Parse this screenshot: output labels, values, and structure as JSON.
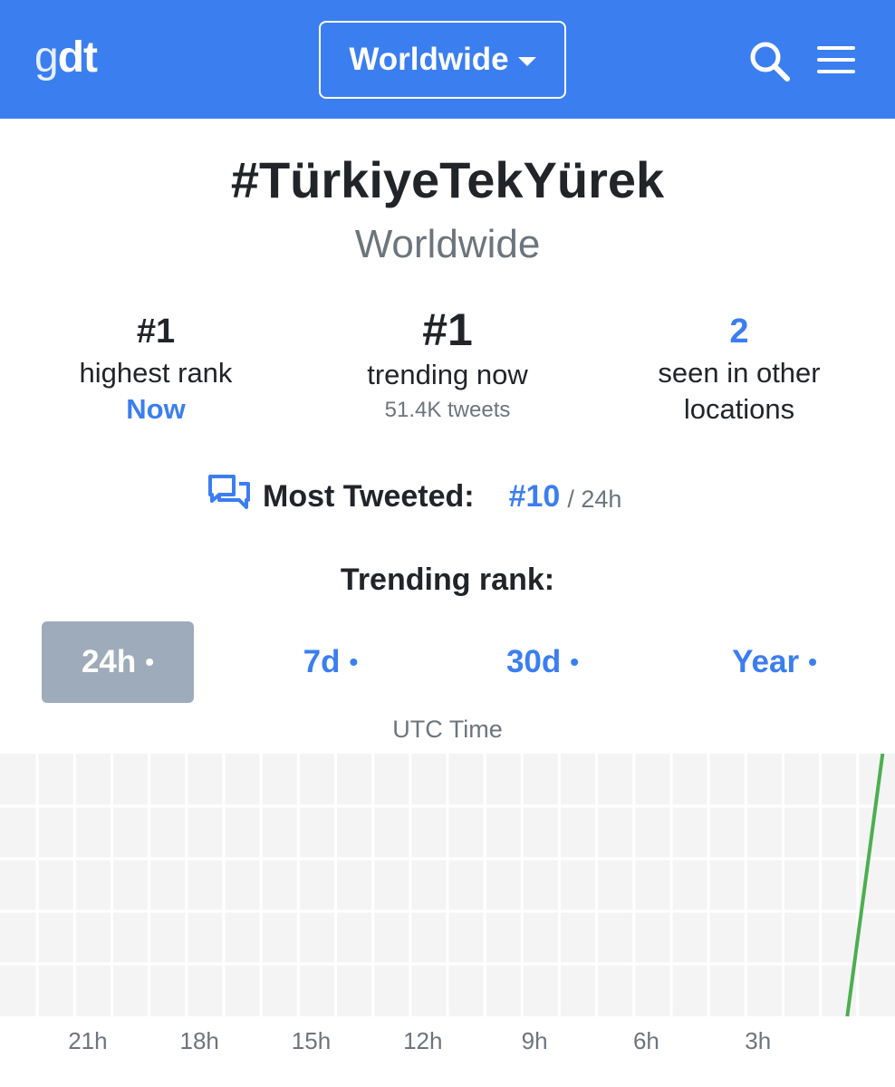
{
  "header": {
    "logo_light": "g",
    "logo_bold": "dt",
    "location_button": "Worldwide",
    "background_color": "#3b7ef0"
  },
  "trend": {
    "title": "#TürkiyeTekYürek",
    "location": "Worldwide"
  },
  "stats": {
    "highest_rank": {
      "value": "#1",
      "label": "highest rank",
      "when": "Now"
    },
    "trending_now": {
      "value": "#1",
      "label": "trending now",
      "tweets": "51.4K tweets"
    },
    "other_locations": {
      "value": "2",
      "label_line1": "seen in other",
      "label_line2": "locations"
    }
  },
  "most_tweeted": {
    "label": "Most Tweeted:",
    "rank": "#10",
    "period": "/ 24h"
  },
  "trending_rank": {
    "heading": "Trending rank:",
    "tabs": [
      {
        "label": "24h",
        "active": true
      },
      {
        "label": "7d",
        "active": false
      },
      {
        "label": "30d",
        "active": false
      },
      {
        "label": "Year",
        "active": false
      }
    ],
    "dot": "•"
  },
  "chart_data": {
    "type": "line",
    "xlabel": "UTC Time",
    "x_ticks": [
      "21h",
      "18h",
      "15h",
      "12h",
      "9h",
      "6h",
      "3h"
    ],
    "series": [
      {
        "color": "#4caf50",
        "points": [
          {
            "x_hours_ago": 0.65,
            "y_fraction": 0.0
          },
          {
            "x_hours_ago": -0.3,
            "y_fraction": 1.0
          }
        ]
      }
    ],
    "grid": true,
    "accent_color": "#4caf50"
  }
}
